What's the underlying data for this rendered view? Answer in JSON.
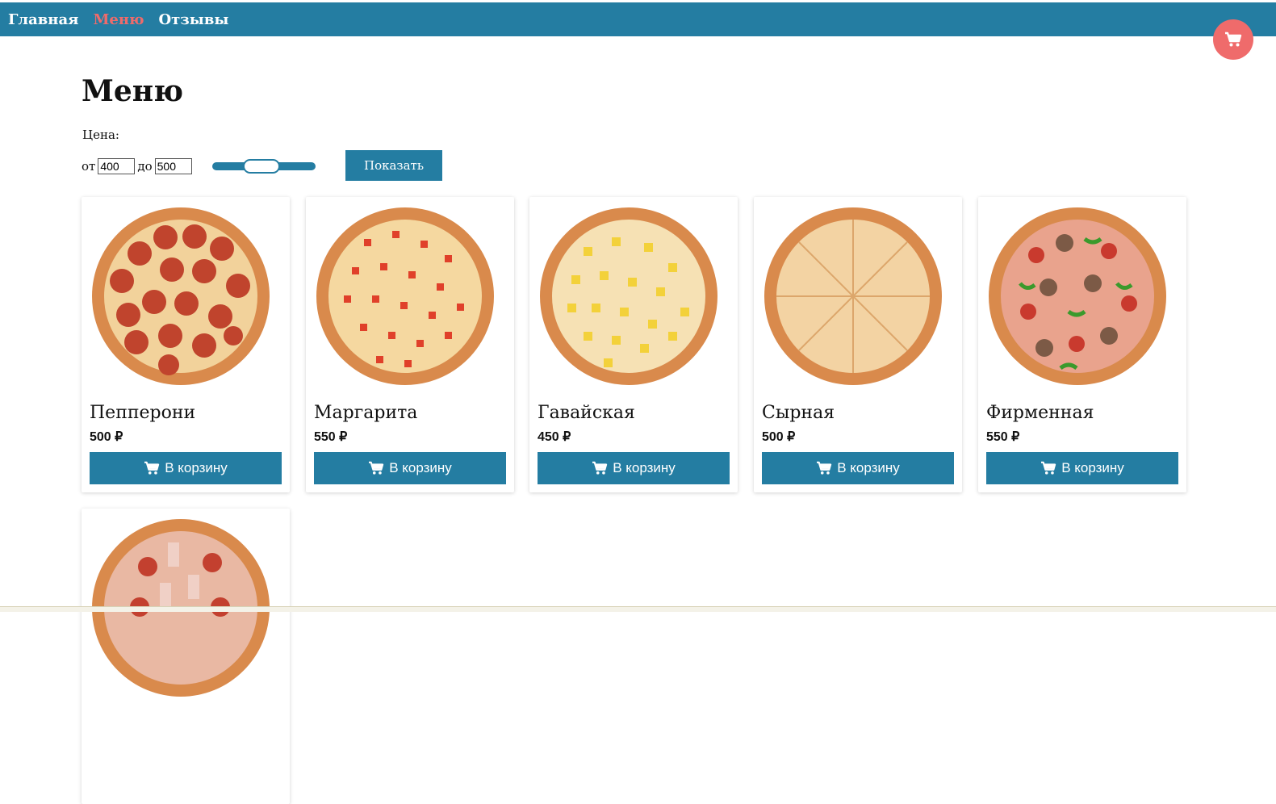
{
  "nav": {
    "items": [
      {
        "label": "Главная",
        "active": false
      },
      {
        "label": "Меню",
        "active": true
      },
      {
        "label": "Отзывы",
        "active": false
      }
    ]
  },
  "cart_icon": "cart-icon",
  "page_title": "Меню",
  "filter": {
    "label": "Цена:",
    "from_label": "от",
    "from_value": "400",
    "to_label": "до",
    "to_value": "500",
    "show_button": "Показать"
  },
  "products": [
    {
      "name": "Пепперони",
      "price": "500 ₽",
      "button": "В корзину",
      "icon": "pepperoni-pizza"
    },
    {
      "name": "Маргарита",
      "price": "550 ₽",
      "button": "В корзину",
      "icon": "margherita-pizza"
    },
    {
      "name": "Гавайская",
      "price": "450 ₽",
      "button": "В корзину",
      "icon": "hawaiian-pizza"
    },
    {
      "name": "Сырная",
      "price": "500 ₽",
      "button": "В корзину",
      "icon": "cheese-pizza"
    },
    {
      "name": "Фирменная",
      "price": "550 ₽",
      "button": "В корзину",
      "icon": "signature-pizza"
    },
    {
      "name": "",
      "price": "",
      "button": "",
      "icon": "meat-pizza"
    }
  ],
  "colors": {
    "primary": "#247da2",
    "accent": "#ef6b6b"
  }
}
